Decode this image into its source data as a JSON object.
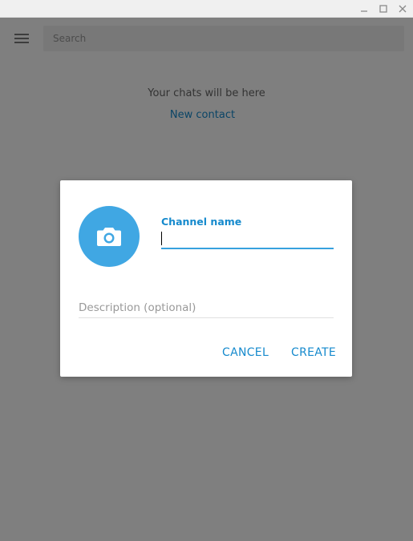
{
  "window": {
    "minimize_icon": "minimize-icon",
    "maximize_icon": "maximize-icon",
    "close_icon": "close-icon"
  },
  "sidebar": {
    "menu_icon": "hamburger-menu-icon",
    "search": {
      "placeholder": "Search",
      "value": ""
    },
    "empty_text": "Your chats will be here",
    "new_contact_link": "New contact"
  },
  "dialog": {
    "photo_icon": "camera-icon",
    "channel_name_label": "Channel name",
    "channel_name_value": "",
    "description_placeholder": "Description (optional)",
    "description_value": "",
    "cancel_label": "CANCEL",
    "create_label": "CREATE"
  },
  "colors": {
    "accent": "#168acd",
    "photo_bg": "#40a7e3",
    "input_underline_active": "#37a1de"
  }
}
